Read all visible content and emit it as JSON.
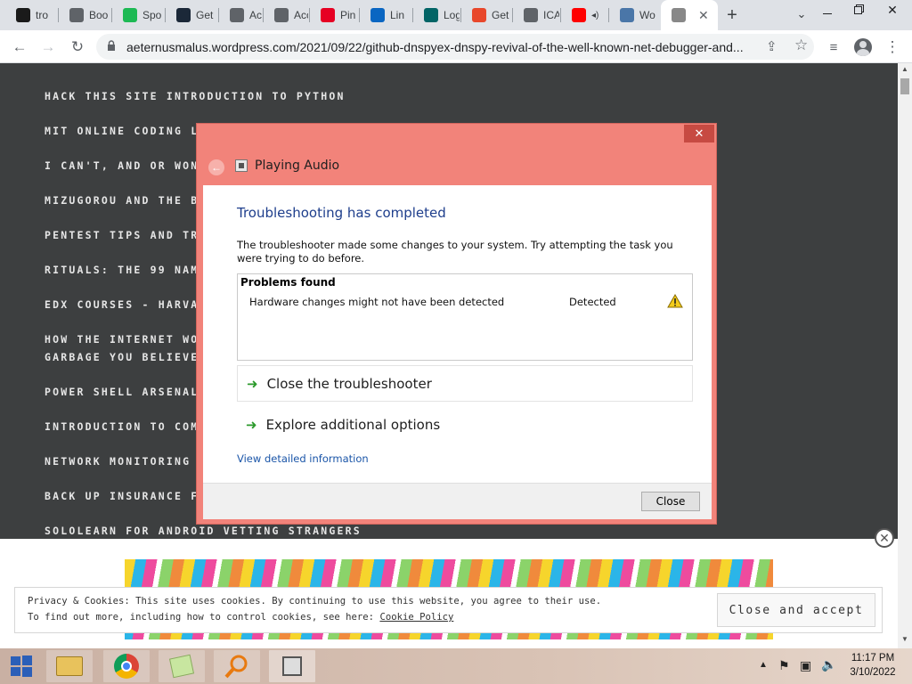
{
  "browser": {
    "tabs": [
      {
        "label": "tro",
        "icon": "book-icon",
        "color": "#1a1a1a"
      },
      {
        "label": "Boo",
        "icon": "star-icon",
        "color": "#5f6368"
      },
      {
        "label": "Spo",
        "icon": "spotify-icon",
        "color": "#1db954"
      },
      {
        "label": "Get",
        "icon": "steam-icon",
        "color": "#1b2838"
      },
      {
        "label": "Acc",
        "icon": "globe-icon",
        "color": "#5f6368"
      },
      {
        "label": "Acc",
        "icon": "globe-icon",
        "color": "#5f6368"
      },
      {
        "label": "Pin",
        "icon": "pinterest-icon",
        "color": "#e60023"
      },
      {
        "label": "Lin",
        "icon": "linkedin-icon",
        "color": "#0a66c2"
      },
      {
        "label": "Log",
        "icon": "xing-icon",
        "color": "#026466"
      },
      {
        "label": "Get",
        "icon": "f-icon",
        "color": "#e8472b"
      },
      {
        "label": "ICA",
        "icon": "link-icon",
        "color": "#5f6368"
      },
      {
        "label": "",
        "icon": "youtube-icon",
        "color": "#ff0000"
      },
      {
        "label": "Wo",
        "icon": "globe-icon",
        "color": "#4a76a8"
      },
      {
        "label": "",
        "icon": "page-icon",
        "color": "#888888"
      }
    ],
    "new_tab": "+",
    "url": "aeternusmalus.wordpress.com/2021/09/22/github-dnspyex-dnspy-revival-of-the-well-known-net-debugger-and..."
  },
  "page": {
    "menu_items": [
      "HACK THIS SITE  INTRODUCTION TO PYTHON",
      "MIT ONLINE CODING L",
      "I CAN'T, AND OR WON",
      "MIZUGOROU AND THE B",
      "PENTEST TIPS AND TR",
      "RITUALS: THE 99 NAM",
      "EDX COURSES - HARVA",
      "HOW THE INTERNET WO",
      "GARBAGE YOU BELIEVE",
      "POWER SHELL ARSENAL",
      "INTRODUCTION TO COM",
      "NETWORK MONITORING",
      "BACK UP INSURANCE F",
      "SOLOLEARN FOR ANDROID  VETTING STRANGERS"
    ]
  },
  "cookie_banner": {
    "line1": "Privacy & Cookies: This site uses cookies. By continuing to use this website, you agree to their use.",
    "line2_prefix": "To find out more, including how to control cookies, see here: ",
    "link": "Cookie Policy",
    "button": "Close and accept"
  },
  "dialog": {
    "window_title": "Playing Audio",
    "close_glyph": "✕",
    "heading": "Troubleshooting has completed",
    "description": "The troubleshooter made some changes to your system. Try attempting the task you were trying to do before.",
    "problems_header": "Problems found",
    "problem": {
      "name": "Hardware changes might not have been detected",
      "status": "Detected"
    },
    "options": [
      "Close the troubleshooter",
      "Explore additional options"
    ],
    "details_link": "View detailed information",
    "close_button": "Close"
  },
  "taskbar": {
    "time": "11:17 PM",
    "date": "3/10/2022"
  }
}
